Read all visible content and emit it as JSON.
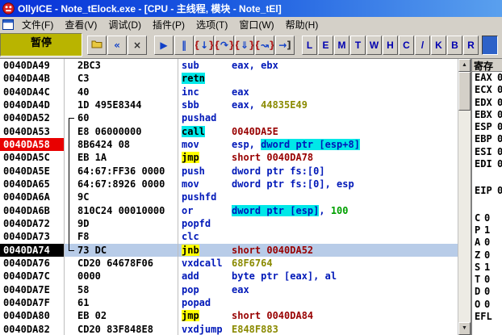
{
  "window": {
    "title": "OllyICE - Note_tElock.exe - [CPU - 主线程, 模块 - Note_tEl]"
  },
  "menu": {
    "items": [
      {
        "key": "file",
        "label": "文件(F)"
      },
      {
        "key": "view",
        "label": "查看(V)"
      },
      {
        "key": "debug",
        "label": "调试(D)"
      },
      {
        "key": "plugins",
        "label": "插件(P)"
      },
      {
        "key": "options",
        "label": "选项(T)"
      },
      {
        "key": "window",
        "label": "窗口(W)"
      },
      {
        "key": "help",
        "label": "帮助(H)"
      }
    ]
  },
  "toolbar": {
    "status": "暂停",
    "buttons": [
      {
        "name": "open-file-button",
        "icon": "open-folder-icon",
        "type": "folder"
      },
      {
        "name": "restart-button",
        "icon": "restart-icon",
        "glyph": "«",
        "color": "#1040C8"
      },
      {
        "name": "close-button",
        "icon": "close-icon",
        "glyph": "×",
        "color": "#303030"
      },
      {
        "name": "run-button",
        "icon": "run-icon",
        "glyph": "▶",
        "color": "#1040C8",
        "gap": true
      },
      {
        "name": "pause-button",
        "icon": "pause-icon",
        "glyph": "‖",
        "color": "#1040C8"
      },
      {
        "name": "step-into-button",
        "icon": "step-into-icon",
        "parts": [
          [
            "{",
            "#B02020"
          ],
          [
            "↓",
            "#1040C8"
          ],
          [
            "}",
            "#B02020"
          ]
        ]
      },
      {
        "name": "step-over-button",
        "icon": "step-over-icon",
        "parts": [
          [
            "{",
            "#B02020"
          ],
          [
            "↷",
            "#1040C8"
          ],
          [
            "}",
            "#B02020"
          ]
        ]
      },
      {
        "name": "trace-into-button",
        "icon": "trace-into-icon",
        "parts": [
          [
            "{",
            "#B02020"
          ],
          [
            "⇓",
            "#1040C8"
          ],
          [
            "}",
            "#B02020"
          ]
        ]
      },
      {
        "name": "trace-over-button",
        "icon": "trace-over-icon",
        "parts": [
          [
            "{",
            "#B02020"
          ],
          [
            "↝",
            "#1040C8"
          ],
          [
            "}",
            "#B02020"
          ]
        ]
      },
      {
        "name": "until-return-button",
        "icon": "until-return-icon",
        "parts": [
          [
            "→",
            "#1040C8"
          ],
          [
            "]",
            "#303030"
          ]
        ]
      }
    ],
    "letters": [
      [
        "L",
        "log-window-button"
      ],
      [
        "E",
        "modules-window-button"
      ],
      [
        "M",
        "memory-window-button"
      ],
      [
        "T",
        "threads-window-button"
      ],
      [
        "W",
        "windows-window-button"
      ],
      [
        "H",
        "handles-window-button"
      ],
      [
        "C",
        "cpu-window-button"
      ],
      [
        "/",
        "patches-window-button"
      ],
      [
        "K",
        "call-stack-window-button"
      ],
      [
        "B",
        "breakpoints-window-button"
      ],
      [
        "R",
        "references-window-button"
      ]
    ],
    "highlighted_button": {
      "name": "active-tool-button",
      "icon": "highlighted-tool-icon"
    }
  },
  "disasm": {
    "rows": [
      {
        "addr": "0040DA49",
        "hex": "2BC3",
        "gutter": "",
        "tokens": [
          [
            "sub",
            "mn"
          ],
          [
            "eax, ebx",
            "op"
          ]
        ]
      },
      {
        "addr": "0040DA4B",
        "hex": "C3",
        "gutter": "",
        "tokens": [
          [
            "retn",
            "call"
          ]
        ]
      },
      {
        "addr": "0040DA4C",
        "hex": "40",
        "gutter": "",
        "tokens": [
          [
            "inc",
            "mn"
          ],
          [
            "eax",
            "op"
          ]
        ]
      },
      {
        "addr": "0040DA4D",
        "hex": "1D 495E8344",
        "gutter": "",
        "tokens": [
          [
            "sbb",
            "mn"
          ],
          [
            "eax, ",
            "op"
          ],
          [
            "44835E49",
            "num"
          ]
        ]
      },
      {
        "addr": "0040DA52",
        "hex": "60",
        "gutter": "ct",
        "tokens": [
          [
            "pushad",
            "mn"
          ]
        ]
      },
      {
        "addr": "0040DA53",
        "hex": "E8 06000000",
        "gutter": "v",
        "tokens": [
          [
            "call",
            "call"
          ],
          [
            "0040DA5E",
            "tgt"
          ]
        ]
      },
      {
        "addr": "0040DA58",
        "hex": "8B6424 08",
        "gutter": "v",
        "addr_style": "breakpoint",
        "tokens": [
          [
            "mov",
            "mn"
          ],
          [
            "esp, ",
            "op"
          ],
          [
            "dword ptr [esp+8]",
            "mem"
          ]
        ]
      },
      {
        "addr": "0040DA5C",
        "hex": "EB 1A",
        "gutter": "v",
        "tokens": [
          [
            "jmp",
            "jmp"
          ],
          [
            "short 0040DA78",
            "tgt"
          ]
        ]
      },
      {
        "addr": "0040DA5E",
        "hex": "64:67:FF36 0000",
        "gutter": "v",
        "tokens": [
          [
            "push",
            "mn"
          ],
          [
            "dword ptr fs:[0]",
            "op"
          ]
        ]
      },
      {
        "addr": "0040DA65",
        "hex": "64:67:8926 0000",
        "gutter": "v",
        "tokens": [
          [
            "mov",
            "mn"
          ],
          [
            "dword ptr fs:[0], esp",
            "op"
          ]
        ]
      },
      {
        "addr": "0040DA6A",
        "hex": "9C",
        "gutter": "v",
        "tokens": [
          [
            "pushfd",
            "mn"
          ]
        ]
      },
      {
        "addr": "0040DA6B",
        "hex": "810C24 00010000",
        "gutter": "v",
        "tokens": [
          [
            "or",
            "mn"
          ],
          [
            "dword ptr [esp]",
            "mem"
          ],
          [
            ", ",
            "op"
          ],
          [
            "100",
            "imm"
          ]
        ]
      },
      {
        "addr": "0040DA72",
        "hex": "9D",
        "gutter": "v",
        "tokens": [
          [
            "popfd",
            "mn"
          ]
        ]
      },
      {
        "addr": "0040DA73",
        "hex": "F8",
        "gutter": "v",
        "tokens": [
          [
            "clc",
            "mn"
          ]
        ]
      },
      {
        "addr": "0040DA74",
        "hex": "73 DC",
        "gutter": "cb",
        "selected": true,
        "addr_style": "selected",
        "tokens": [
          [
            "jnb",
            "jmp"
          ],
          [
            "short 0040DA52",
            "tgt"
          ]
        ]
      },
      {
        "addr": "0040DA76",
        "hex": "CD20 64678F06",
        "gutter": "",
        "tokens": [
          [
            "vxdcall",
            "mn"
          ],
          [
            "68F6764",
            "num"
          ]
        ]
      },
      {
        "addr": "0040DA7C",
        "hex": "0000",
        "gutter": "",
        "tokens": [
          [
            "add",
            "mn"
          ],
          [
            "byte ptr [eax], al",
            "op"
          ]
        ]
      },
      {
        "addr": "0040DA7E",
        "hex": "58",
        "gutter": "",
        "tokens": [
          [
            "pop",
            "mn"
          ],
          [
            "eax",
            "op"
          ]
        ]
      },
      {
        "addr": "0040DA7F",
        "hex": "61",
        "gutter": "",
        "tokens": [
          [
            "popad",
            "mn"
          ]
        ]
      },
      {
        "addr": "0040DA80",
        "hex": "EB 02",
        "gutter": "",
        "tokens": [
          [
            "jmp",
            "jmp"
          ],
          [
            "short 0040DA84",
            "tgt"
          ]
        ]
      },
      {
        "addr": "0040DA82",
        "hex": "CD20 83F848E8",
        "gutter": "",
        "tokens": [
          [
            "vxdjump",
            "mn"
          ],
          [
            "E848F883",
            "num"
          ]
        ]
      }
    ]
  },
  "registers": {
    "title": "寄存",
    "regs": [
      [
        "EAX",
        "0"
      ],
      [
        "ECX",
        "0"
      ],
      [
        "EDX",
        "0"
      ],
      [
        "EBX",
        "0"
      ],
      [
        "ESP",
        "0"
      ],
      [
        "EBP",
        "0"
      ],
      [
        "ESI",
        "0"
      ],
      [
        "EDI",
        "0"
      ]
    ],
    "eip": [
      "EIP",
      "0"
    ],
    "flags": [
      [
        "C",
        "0"
      ],
      [
        "P",
        "1"
      ],
      [
        "A",
        "0"
      ],
      [
        "Z",
        "0"
      ],
      [
        "S",
        "1"
      ],
      [
        "T",
        "0"
      ],
      [
        "D",
        "0"
      ],
      [
        "O",
        "0"
      ]
    ],
    "efl_label": "EFL"
  },
  "colors": {
    "title_blue": "#1A5AE0",
    "status_olive": "#B9B400",
    "breakpoint_red": "#E80000",
    "selection_blue": "#B8CCE8",
    "call_cyan": "#00E8E8",
    "jump_yellow": "#FFFF00",
    "mnemonic_blue": "#0018B8",
    "constant_olive": "#8A8A00",
    "target_maroon": "#980000",
    "immediate_green": "#00A000"
  }
}
